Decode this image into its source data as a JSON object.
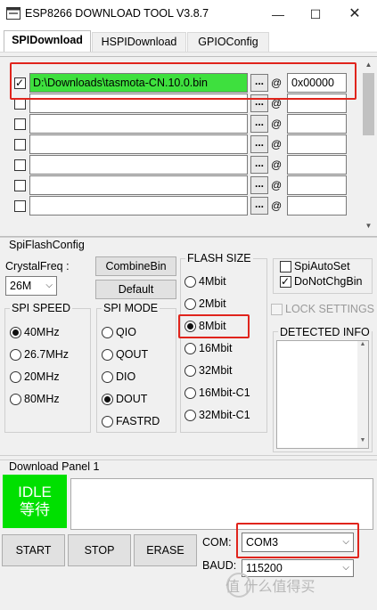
{
  "window": {
    "title": "ESP8266 DOWNLOAD TOOL V3.8.7",
    "min_glyph": "—",
    "max_glyph": "☐",
    "close_glyph": "✕"
  },
  "tabs": [
    "SPIDownload",
    "HSPIDownload",
    "GPIOConfig"
  ],
  "files": [
    {
      "checked": true,
      "path": "D:\\Downloads\\tasmota-CN.10.0.bin",
      "address": "0x00000"
    },
    {
      "checked": false,
      "path": "",
      "address": ""
    },
    {
      "checked": false,
      "path": "",
      "address": ""
    },
    {
      "checked": false,
      "path": "",
      "address": ""
    },
    {
      "checked": false,
      "path": "",
      "address": ""
    },
    {
      "checked": false,
      "path": "",
      "address": ""
    },
    {
      "checked": false,
      "path": "",
      "address": ""
    }
  ],
  "browse_label": "...",
  "at_label": "@",
  "spiflash": {
    "title": "SpiFlashConfig",
    "crystal_label": "CrystalFreq :",
    "crystal_value": "26M",
    "combine_bin": "CombineBin",
    "default": "Default",
    "spi_speed": {
      "title": "SPI SPEED",
      "options": [
        "40MHz",
        "26.7MHz",
        "20MHz",
        "80MHz"
      ],
      "selected": "40MHz"
    },
    "spi_mode": {
      "title": "SPI MODE",
      "options": [
        "QIO",
        "QOUT",
        "DIO",
        "DOUT",
        "FASTRD"
      ],
      "selected": "DOUT"
    },
    "flash_size": {
      "title": "FLASH SIZE",
      "options": [
        "4Mbit",
        "2Mbit",
        "8Mbit",
        "16Mbit",
        "32Mbit",
        "16Mbit-C1",
        "32Mbit-C1"
      ],
      "selected": "8Mbit"
    },
    "spi_auto_set": "SpiAutoSet",
    "do_not_chg_bin": "DoNotChgBin",
    "lock_settings": "LOCK SETTINGS",
    "detected_info": "DETECTED INFO"
  },
  "download": {
    "title": "Download Panel 1",
    "status_en": "IDLE",
    "status_cn": "等待",
    "start": "START",
    "stop": "STOP",
    "erase": "ERASE",
    "com_label": "COM:",
    "com_value": "COM3",
    "baud_label": "BAUD:",
    "baud_value": "115200"
  },
  "watermark": "值 什么值得买",
  "colors": {
    "highlight_green": "#3ee03e",
    "idle_green": "#00e000",
    "annotation_red": "#e0241c"
  }
}
